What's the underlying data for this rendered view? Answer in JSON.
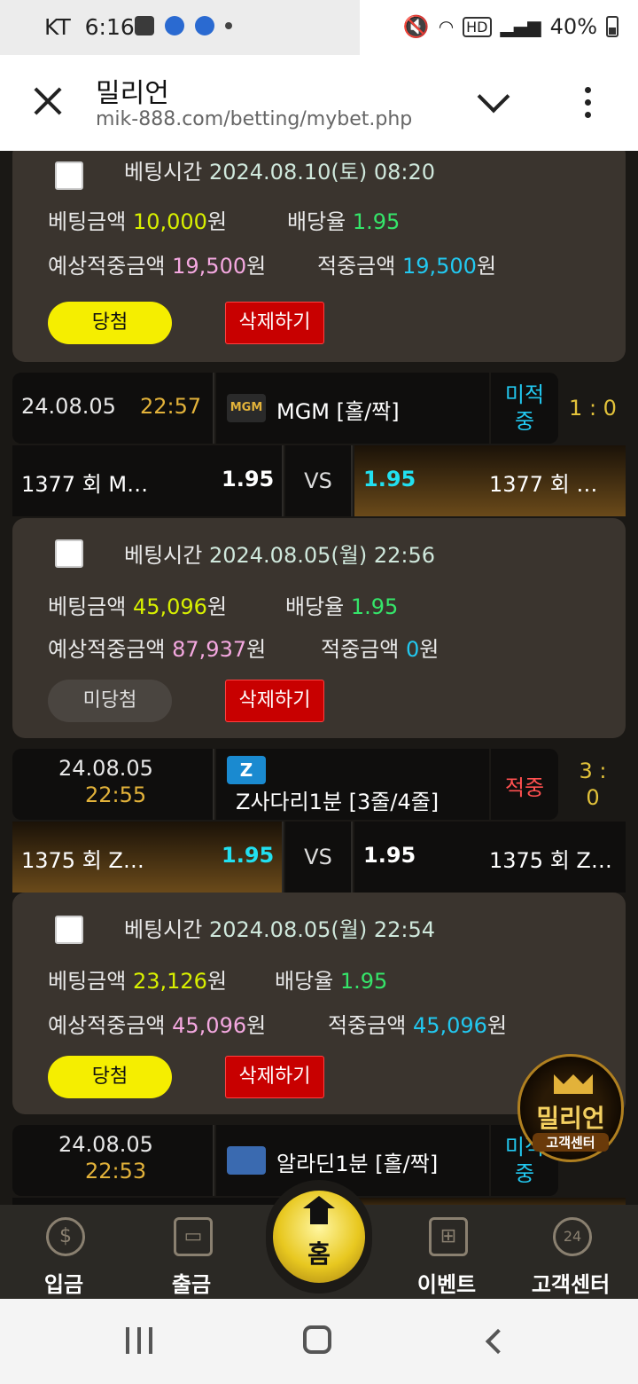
{
  "status_bar": {
    "carrier": "KT",
    "time": "6:16",
    "dot": "•",
    "hd": "HD",
    "battery": "40%"
  },
  "browser": {
    "title": "밀리언",
    "url": "mik-888.com/betting/mybet.php"
  },
  "bets": [
    {
      "time_label": "베팅시간",
      "time_value": "2024.08.10(토) 08:20",
      "amount_label": "베팅금액",
      "amount": "10,000",
      "won": "원",
      "rate_label": "배당율",
      "rate": "1.95",
      "expect_label": "예상적중금액",
      "expect": "19,500",
      "hit_label": "적중금액",
      "hit": "19,500",
      "result": "당첨",
      "delete": "삭제하기"
    },
    {
      "time_label": "베팅시간",
      "time_value": "2024.08.05(월) 22:56",
      "amount_label": "베팅금액",
      "amount": "45,096",
      "won": "원",
      "rate_label": "배당율",
      "rate": "1.95",
      "expect_label": "예상적중금액",
      "expect": "87,937",
      "hit_label": "적중금액",
      "hit": "0",
      "result": "미당첨",
      "delete": "삭제하기"
    },
    {
      "time_label": "베팅시간",
      "time_value": "2024.08.05(월) 22:54",
      "amount_label": "베팅금액",
      "amount": "23,126",
      "won": "원",
      "rate_label": "배당율",
      "rate": "1.95",
      "expect_label": "예상적중금액",
      "expect": "45,096",
      "hit_label": "적중금액",
      "hit": "45,096",
      "result": "당첨",
      "delete": "삭제하기"
    }
  ],
  "games": [
    {
      "date": "24.08.05",
      "time": "22:57",
      "name": "MGM [홀/짝]",
      "logo_text": "MGM",
      "status": "미적중",
      "score": "1 : 0",
      "home_team": "1377 회 M…",
      "home_odd": "1.95",
      "vs": "VS",
      "away_odd": "1.95",
      "away_team": "1377 회 …"
    },
    {
      "date": "24.08.05",
      "time": "22:55",
      "name": "Z사다리1분 [3줄/4줄]",
      "logo_text": "Z",
      "status": "적중",
      "score": "3 : 0",
      "home_team": "1375 회 Z…",
      "home_odd": "1.95",
      "vs": "VS",
      "away_odd": "1.95",
      "away_team": "1375 회 Z…"
    },
    {
      "date": "24.08.05",
      "time": "22:53",
      "name": "알라딘1분 [홀/짝]",
      "status": "미적중"
    }
  ],
  "nav": {
    "deposit": "입금",
    "withdraw": "출금",
    "home": "홈",
    "event": "이벤트",
    "support": "고객센터"
  },
  "badge": {
    "title": "밀리언",
    "sub": "고객센터"
  },
  "colors": {
    "win": "#f5ee00",
    "delete": "#c80000",
    "lose": "#ff5050",
    "pending": "#22c8f0"
  }
}
